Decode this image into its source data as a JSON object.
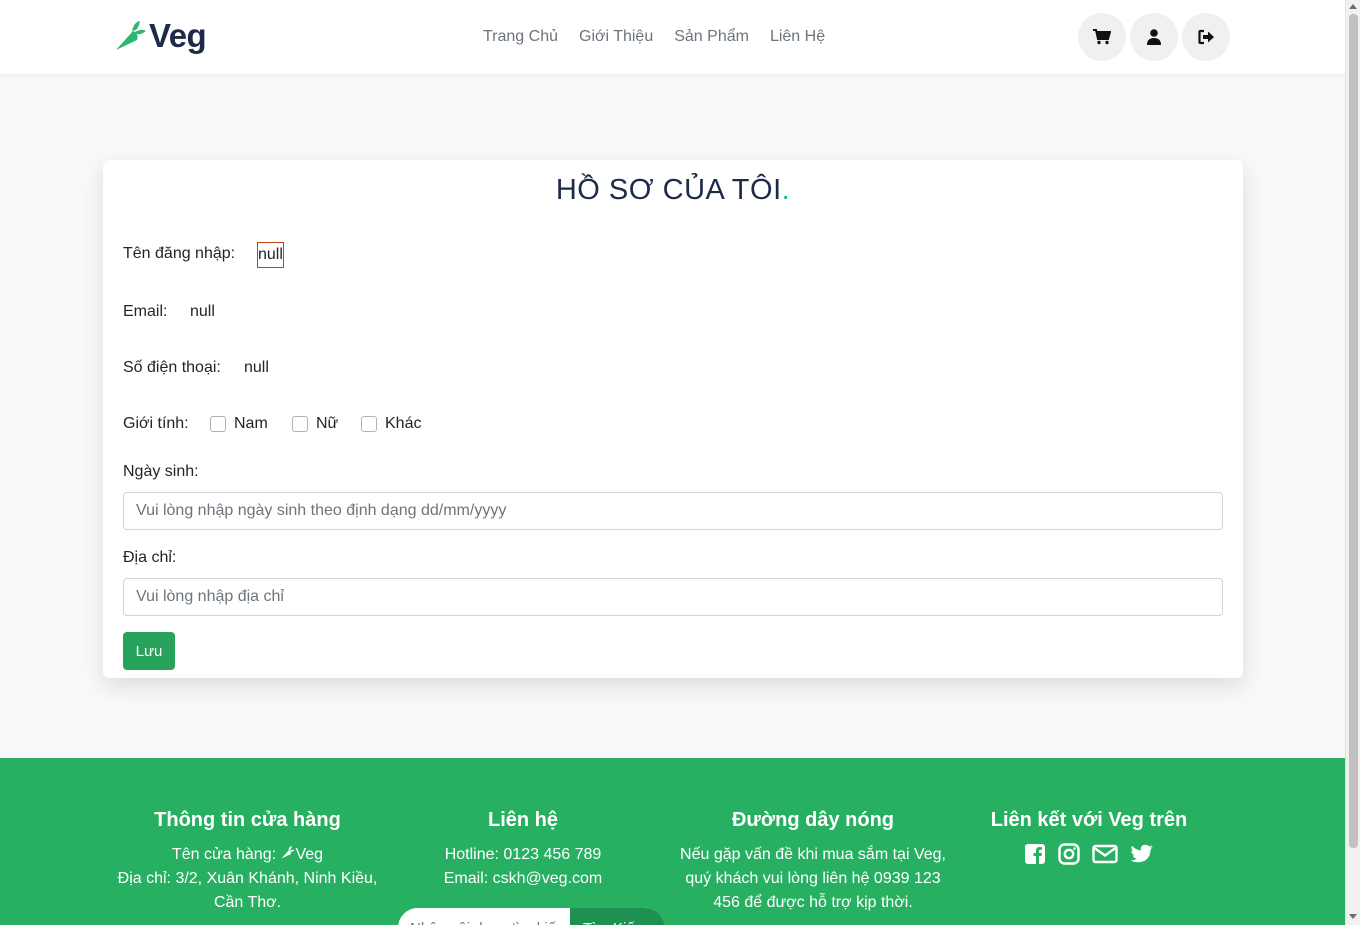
{
  "brand": {
    "name": "Veg",
    "accent": "#2bb673",
    "dark": "#1e2a4a",
    "footer_bg": "#28b062"
  },
  "nav": {
    "links": [
      "Trang Chủ",
      "Giới Thiệu",
      "Sản Phẩm",
      "Liên Hệ"
    ],
    "icons": [
      "cart-icon",
      "user-icon",
      "sign-out-icon"
    ]
  },
  "profile": {
    "title": "HỒ SƠ CỦA TÔI",
    "title_dot": ".",
    "username_label": "Tên đăng nhập:",
    "username_value": "null",
    "email_label": "Email:",
    "email_value": "null",
    "phone_label": "Số điện thoại:",
    "phone_value": "null",
    "gender_label": "Giới tính:",
    "gender_options": [
      "Nam",
      "Nữ",
      "Khác"
    ],
    "dob_label": "Ngày sinh:",
    "dob_placeholder": "Vui lòng nhập ngày sinh theo định dạng dd/mm/yyyy",
    "address_label": "Địa chỉ:",
    "address_placeholder": "Vui lòng nhập địa chỉ",
    "save_label": "Lưu"
  },
  "footer": {
    "store": {
      "title": "Thông tin cửa hàng",
      "name_prefix": "Tên cửa hàng:",
      "name_value": "Veg",
      "address_line1": "Địa chỉ: 3/2, Xuân Khánh, Ninh Kiều,",
      "address_line2": "Cần Thơ."
    },
    "contact": {
      "title": "Liên hệ",
      "hotline": "Hotline: 0123 456 789",
      "email": "Email: cskh@veg.com",
      "search_placeholder": "Nhập nội dung tìm kiếm",
      "search_button": "Tìm Kiếm"
    },
    "hotline": {
      "title": "Đường dây nóng",
      "line1": "Nếu gặp vấn đề khi mua sắm tại Veg,",
      "line2": "quý khách vui lòng liên hệ 0939 123",
      "line3": "456 để được hỗ trợ kịp thời."
    },
    "social": {
      "title": "Liên kết với Veg trên",
      "icons": [
        "facebook-icon",
        "instagram-icon",
        "envelope-icon",
        "twitter-icon"
      ]
    }
  }
}
